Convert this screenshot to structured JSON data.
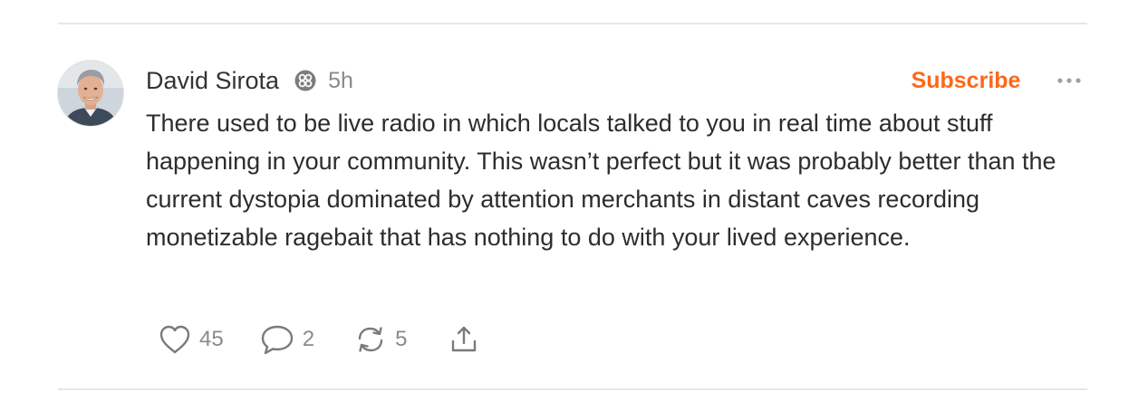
{
  "post": {
    "author": "David Sirota",
    "time": "5h",
    "subscribe_label": "Subscribe",
    "text": "There used to be live radio in which locals talked to you in real time about stuff happening in your community. This wasn’t perfect but it was probably better than the current dystopia dominated by attention merchants in distant caves recording monetizable ragebait that has nothing to do with your lived experience.",
    "likes": "45",
    "comments": "2",
    "restacks": "5"
  },
  "icons": {
    "avatar": "author-avatar",
    "badge": "substack-badge-icon",
    "more": "more-options-icon",
    "like": "heart-icon",
    "comment": "comment-bubble-icon",
    "restack": "restack-icon",
    "share": "share-icon"
  },
  "colors": {
    "accent": "#ff6719",
    "muted": "#8a8a8a",
    "text": "#2d2d2d",
    "divider": "#e6e6e6"
  }
}
